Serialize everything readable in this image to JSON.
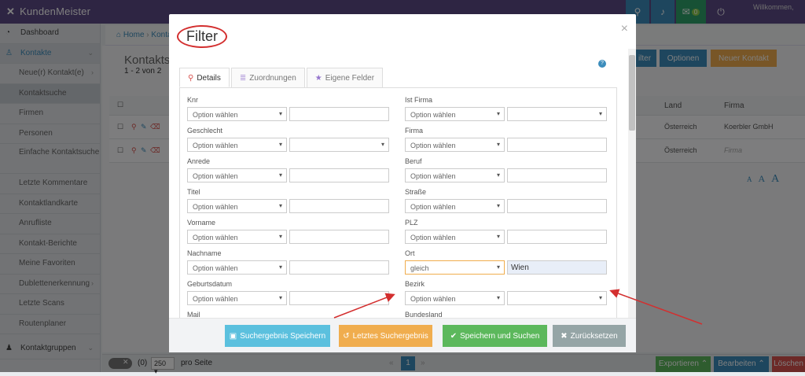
{
  "topbar": {
    "brand": "KundenMeister",
    "badge": "0",
    "welcome": "Willkommen,"
  },
  "sidebar": {
    "dashboard": "Dashboard",
    "kontakte": "Kontakte",
    "items": [
      "Neue(r) Kontakt(e)",
      "Kontaktsuche",
      "Firmen",
      "Personen",
      "Einfache Kontaktsuche",
      "Letzte Kommentare",
      "Kontaktlandkarte",
      "Anrufliste",
      "Kontakt-Berichte",
      "Meine Favoriten",
      "Dublettenerkennung",
      "Letzte Scans",
      "Routenplaner"
    ],
    "kontaktgruppen": "Kontaktgruppen"
  },
  "breadcrumb": {
    "home": "Home",
    "sep": "›",
    "current": "Konta"
  },
  "background": {
    "title": "Kontaktsu",
    "count": "1 - 2 von 2",
    "filter_btn": "ilter",
    "optionen_btn": "Optionen",
    "neuer_btn": "Neuer Kontakt",
    "col_land": "Land",
    "col_firma": "Firma",
    "rows": [
      {
        "land": "Österreich",
        "firma": "Koerbler GmbH"
      },
      {
        "land": "Österreich",
        "firma": "Firma"
      }
    ],
    "fontsizes": [
      "A",
      "A",
      "A"
    ]
  },
  "footer": {
    "count": "(0)",
    "per_page": "250",
    "per_page_label": "pro Seite",
    "page": "1",
    "prev": "«",
    "next": "»",
    "export": "Exportieren",
    "edit": "Bearbeiten",
    "delete": "Löschen"
  },
  "modal": {
    "title": "Filter",
    "close": "×",
    "help": "?",
    "tabs": [
      {
        "label": "Details",
        "icon": "search-icon"
      },
      {
        "label": "Zuordnungen",
        "icon": "list-icon"
      },
      {
        "label": "Eigene Felder",
        "icon": "star-icon"
      }
    ],
    "default_option": "Option wählen",
    "left": [
      {
        "label": "Knr",
        "select": "Option wählen",
        "value": "",
        "type": "input"
      },
      {
        "label": "Geschlecht",
        "select": "Option wählen",
        "value": "",
        "type": "select"
      },
      {
        "label": "Anrede",
        "select": "Option wählen",
        "value": "",
        "type": "input"
      },
      {
        "label": "Titel",
        "select": "Option wählen",
        "value": "",
        "type": "input"
      },
      {
        "label": "Vorname",
        "select": "Option wählen",
        "value": "",
        "type": "input"
      },
      {
        "label": "Nachname",
        "select": "Option wählen",
        "value": "",
        "type": "input"
      },
      {
        "label": "Geburtsdatum",
        "select": "Option wählen",
        "value": "",
        "type": "input"
      },
      {
        "label": "Mail",
        "select": "",
        "value": "",
        "type": "input"
      }
    ],
    "right": [
      {
        "label": "Ist Firma",
        "select": "Option wählen",
        "value": "",
        "type": "select"
      },
      {
        "label": "Firma",
        "select": "Option wählen",
        "value": "",
        "type": "input"
      },
      {
        "label": "Beruf",
        "select": "Option wählen",
        "value": "",
        "type": "input"
      },
      {
        "label": "Straße",
        "select": "Option wählen",
        "value": "",
        "type": "input"
      },
      {
        "label": "PLZ",
        "select": "Option wählen",
        "value": "",
        "type": "input"
      },
      {
        "label": "Ort",
        "select": "gleich",
        "value": "Wien",
        "type": "input"
      },
      {
        "label": "Bezirk",
        "select": "Option wählen",
        "value": "",
        "type": "select"
      },
      {
        "label": "Bundesland",
        "select": "",
        "value": "",
        "type": "input"
      }
    ],
    "buttons": {
      "save_result": "Suchergebnis Speichern",
      "last_result": "Letztes Suchergebnis",
      "save_search": "Speichern und Suchen",
      "reset": "Zurücksetzen"
    }
  },
  "colors": {
    "brand": "#5c4a86",
    "primary": "#3c8dbc",
    "warning": "#f0ad4e",
    "success": "#5cb85c",
    "muted": "#95a5a6",
    "annotation": "#d32f2f"
  }
}
